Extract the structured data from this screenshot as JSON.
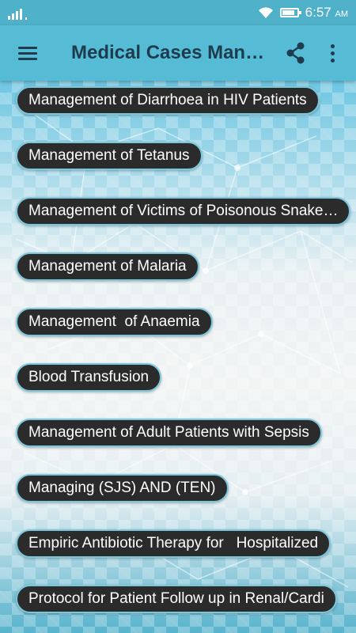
{
  "status_bar": {
    "time": "6:57",
    "ampm": "AM",
    "icons": [
      "signal-icon",
      "wifi-icon",
      "battery-icon"
    ],
    "battery_level": 0.85
  },
  "app_bar": {
    "title": "Medical Cases Man…",
    "icons": [
      "menu-icon",
      "share-icon",
      "more-vert-icon"
    ]
  },
  "list": {
    "items": [
      {
        "label": "Management of Diarrhoea in HIV Patients"
      },
      {
        "label": "Management of Tetanus"
      },
      {
        "label": "Management of Victims of Poisonous Snake…"
      },
      {
        "label": "Management of Malaria"
      },
      {
        "label": "Management  of Anaemia"
      },
      {
        "label": "Blood Transfusion"
      },
      {
        "label": "Management of Adult Patients with Sepsis"
      },
      {
        "label": "Managing (SJS) AND (TEN)"
      },
      {
        "label": "Empiric Antibiotic Therapy for   Hospitalized"
      },
      {
        "label": "Protocol for Patient Follow up in Renal/Cardi"
      }
    ]
  },
  "colors": {
    "status_bar": "#4fb0c9",
    "app_bar": "#56bcd5",
    "pill_bg": "#2b2b2b",
    "pill_border": "#7ac8de"
  }
}
